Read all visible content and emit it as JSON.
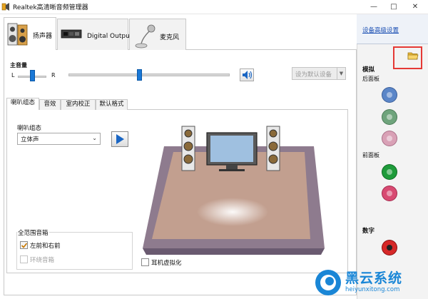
{
  "window": {
    "title": "Realtek高清晰音频管理器",
    "minimize": "—",
    "maximize": "□",
    "close": "✕"
  },
  "tabs": [
    {
      "label": "扬声器",
      "icon": "speaker-tab-icon",
      "active": true
    },
    {
      "label": "Digital Output",
      "icon": "digital-output-icon",
      "active": false
    },
    {
      "label": "麦克风",
      "icon": "microphone-icon",
      "active": false
    }
  ],
  "volume": {
    "title": "主音量",
    "left_label": "L",
    "right_label": "R",
    "balance": 0.5,
    "level": 0.45,
    "mute_icon": "speaker-volume-icon"
  },
  "default_device_button": "设为默认设备",
  "subtabs": [
    "喇叭组态",
    "音效",
    "室内校正",
    "默认格式"
  ],
  "speaker_config": {
    "label": "喇叭组态",
    "selected": "立体声",
    "play_icon": "play-icon"
  },
  "full_range": {
    "label": "全范围音箱",
    "front_label": "左前和右前",
    "front_checked": true,
    "surround_label": "环绕音箱",
    "surround_checked": false,
    "surround_disabled": true
  },
  "headphone_virtualization": {
    "label": "耳机虚拟化",
    "checked": false
  },
  "side_panel": {
    "advanced_link": "设备高级设置",
    "analog_title": "模拟",
    "back_panel": "后面板",
    "front_panel": "前面板",
    "digital_title": "数字",
    "folder_icon": "folder-icon",
    "back_jacks": [
      {
        "color": "#5b86c8"
      },
      {
        "color": "#6fa47c"
      },
      {
        "color": "#d9a1b6"
      }
    ],
    "front_jacks": [
      {
        "color": "#1e9b3a"
      },
      {
        "color": "#d84a72"
      }
    ],
    "digital_jack": {
      "color": "#d62828"
    }
  },
  "watermark": {
    "name": "黑云系统",
    "url": "heiyunxitong.com"
  }
}
